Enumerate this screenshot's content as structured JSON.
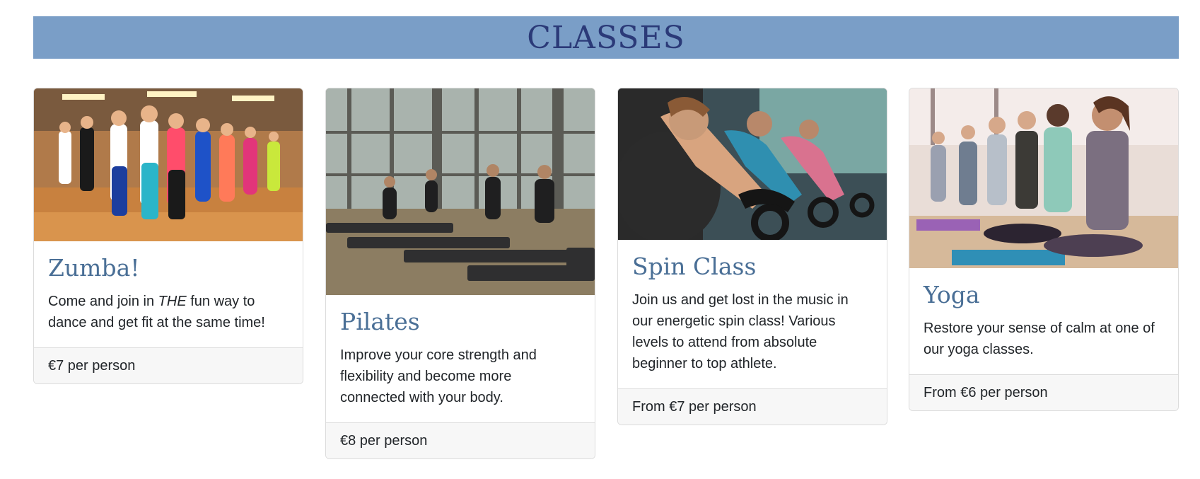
{
  "header": {
    "title": "CLASSES"
  },
  "classes": [
    {
      "title": "Zumba!",
      "text_before": "Come and join in ",
      "text_emphasis": "THE",
      "text_after": " fun way to dance and get fit at the same time!",
      "price": "€7 per person",
      "image": "zumba-dance-class-photo"
    },
    {
      "title": "Pilates",
      "text": "Improve your core strength and flexibility and become more connected with your body.",
      "price": "€8 per person",
      "image": "pilates-reformer-class-photo"
    },
    {
      "title": "Spin Class",
      "text": "Join us and get lost in the music in our energetic spin class! Various levels to attend from absolute beginner to top athlete.",
      "price": "From €7 per person",
      "image": "spin-cycling-class-photo"
    },
    {
      "title": "Yoga",
      "text": "Restore your sense of calm at one of our yoga classes.",
      "price": "From €6 per person",
      "image": "yoga-meditation-class-photo"
    }
  ],
  "colors": {
    "banner": "#7a9ec7",
    "banner_text": "#2b3a78",
    "card_title": "#4a6f96",
    "footer_bg": "#f7f7f7"
  }
}
